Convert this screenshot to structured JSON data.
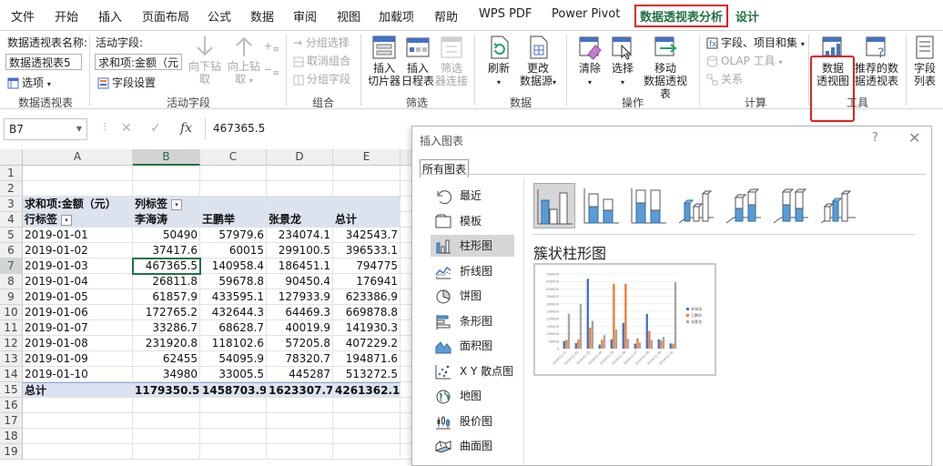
{
  "menu": {
    "tabs": [
      {
        "label": "文件"
      },
      {
        "label": "开始"
      },
      {
        "label": "插入"
      },
      {
        "label": "页面布局"
      },
      {
        "label": "公式"
      },
      {
        "label": "数据"
      },
      {
        "label": "审阅"
      },
      {
        "label": "视图"
      },
      {
        "label": "加载项"
      },
      {
        "label": "帮助"
      },
      {
        "label": "WPS PDF"
      },
      {
        "label": "Power Pivot"
      },
      {
        "label": "数据透视表分析"
      },
      {
        "label": "设计"
      }
    ]
  },
  "ribbon": {
    "pivot": {
      "name_label": "数据透视表名称:",
      "name_value": "数据透视表5",
      "options": "选项",
      "group": "数据透视表"
    },
    "field": {
      "label": "活动字段:",
      "value": "求和项:金额（元）",
      "settings": "字段设置",
      "drill_down": "向下钻取",
      "drill_up_1": "向上钻",
      "drill_up_2": "取",
      "group": "活动字段"
    },
    "grouping": {
      "select": "→ 分组选择",
      "ungroup": "取消组合",
      "group_field": "分组字段",
      "group": "组合"
    },
    "filter": {
      "slicer_1": "插入",
      "slicer_2": "切片器",
      "timeline_1": "插入",
      "timeline_2": "日程表",
      "conn_1": "筛选",
      "conn_2": "器连接",
      "group": "筛选"
    },
    "data": {
      "refresh": "刷新",
      "source_1": "更改",
      "source_2": "数据源",
      "group": "数据"
    },
    "actions": {
      "clear": "清除",
      "select": "选择",
      "move_1": "移动",
      "move_2": "数据透视表",
      "group": "操作"
    },
    "calc": {
      "fields": "字段、项目和集",
      "olap": "OLAP 工具",
      "relations": "关系",
      "group": "计算"
    },
    "tools": {
      "pivotchart_1": "数据",
      "pivotchart_2": "透视图",
      "recommended_1": "推荐的数",
      "recommended_2": "据透视表",
      "group": "工具"
    },
    "show": {
      "fieldlist_1": "字段",
      "fieldlist_2": "列表"
    }
  },
  "formula": {
    "name_box": "B7",
    "fx": "fx",
    "value": "467365.5"
  },
  "sheet": {
    "columns": [
      "A",
      "B",
      "C",
      "D",
      "E"
    ],
    "rows": [
      "1",
      "2",
      "3",
      "4",
      "5",
      "6",
      "7",
      "8",
      "9",
      "10",
      "11",
      "12",
      "13",
      "14",
      "15",
      "16",
      "17",
      "18",
      "19"
    ],
    "pivot_value_label": "求和项:金额（元）",
    "col_labels": "列标签",
    "row_labels": "行标签",
    "headers": [
      "李海涛",
      "王鹏举",
      "张景龙",
      "总计"
    ],
    "data": [
      {
        "date": "2019-01-01",
        "v": [
          "50490",
          "57979.6",
          "234074.1",
          "342543.7"
        ]
      },
      {
        "date": "2019-01-02",
        "v": [
          "37417.6",
          "60015",
          "299100.5",
          "396533.1"
        ]
      },
      {
        "date": "2019-01-03",
        "v": [
          "467365.5",
          "140958.4",
          "186451.1",
          "794775"
        ]
      },
      {
        "date": "2019-01-04",
        "v": [
          "26811.8",
          "59678.8",
          "90450.4",
          "176941"
        ]
      },
      {
        "date": "2019-01-05",
        "v": [
          "61857.9",
          "433595.1",
          "127933.9",
          "623386.9"
        ]
      },
      {
        "date": "2019-01-06",
        "v": [
          "172765.2",
          "432644.3",
          "64469.3",
          "669878.8"
        ]
      },
      {
        "date": "2019-01-07",
        "v": [
          "33286.7",
          "68628.7",
          "40019.9",
          "141930.3"
        ]
      },
      {
        "date": "2019-01-08",
        "v": [
          "231920.8",
          "118102.6",
          "57205.8",
          "407229.2"
        ]
      },
      {
        "date": "2019-01-09",
        "v": [
          "62455",
          "54095.9",
          "78320.7",
          "194871.6"
        ]
      },
      {
        "date": "2019-01-10",
        "v": [
          "34980",
          "33005.5",
          "445287",
          "513272.5"
        ]
      }
    ],
    "total_label": "总计",
    "totals": [
      "1179350.5",
      "1458703.9",
      "1623307.7",
      "4261362.1"
    ]
  },
  "dialog": {
    "title": "插入图表",
    "help": "?",
    "close": "✕",
    "tab": "所有图表",
    "chart_types": [
      {
        "label": "最近",
        "icon": "recent-icon"
      },
      {
        "label": "模板",
        "icon": "template-icon"
      },
      {
        "label": "柱形图",
        "icon": "column-chart-icon"
      },
      {
        "label": "折线图",
        "icon": "line-chart-icon"
      },
      {
        "label": "饼图",
        "icon": "pie-chart-icon"
      },
      {
        "label": "条形图",
        "icon": "bar-chart-icon"
      },
      {
        "label": "面积图",
        "icon": "area-chart-icon"
      },
      {
        "label": "X Y 散点图",
        "icon": "scatter-chart-icon"
      },
      {
        "label": "地图",
        "icon": "map-chart-icon"
      },
      {
        "label": "股价图",
        "icon": "stock-chart-icon"
      },
      {
        "label": "曲面图",
        "icon": "surface-chart-icon"
      }
    ],
    "selected_type": "柱形图",
    "subtype_name": "簇状柱形图",
    "preview": {
      "y_ticks": [
        "500000",
        "450000",
        "400000",
        "350000",
        "300000",
        "250000",
        "200000",
        "150000",
        "100000",
        "50000",
        "0"
      ],
      "categories": [
        "2019-01-01",
        "2019-01-02",
        "2019-01-03",
        "2019-01-04",
        "2019-01-05",
        "2019-01-06",
        "2019-01-07",
        "2019-01-08",
        "2019-01-09",
        "2019-01-10"
      ],
      "series": [
        {
          "name": "李海涛",
          "color": "#4472c4"
        },
        {
          "name": "王鹏举",
          "color": "#ed7d31"
        },
        {
          "name": "张景龙",
          "color": "#a5a5a5"
        }
      ]
    }
  },
  "colors": {
    "excel_green": "#217346",
    "highlight_red": "#e02020",
    "pivot_header_bg": "#dce3f0"
  }
}
